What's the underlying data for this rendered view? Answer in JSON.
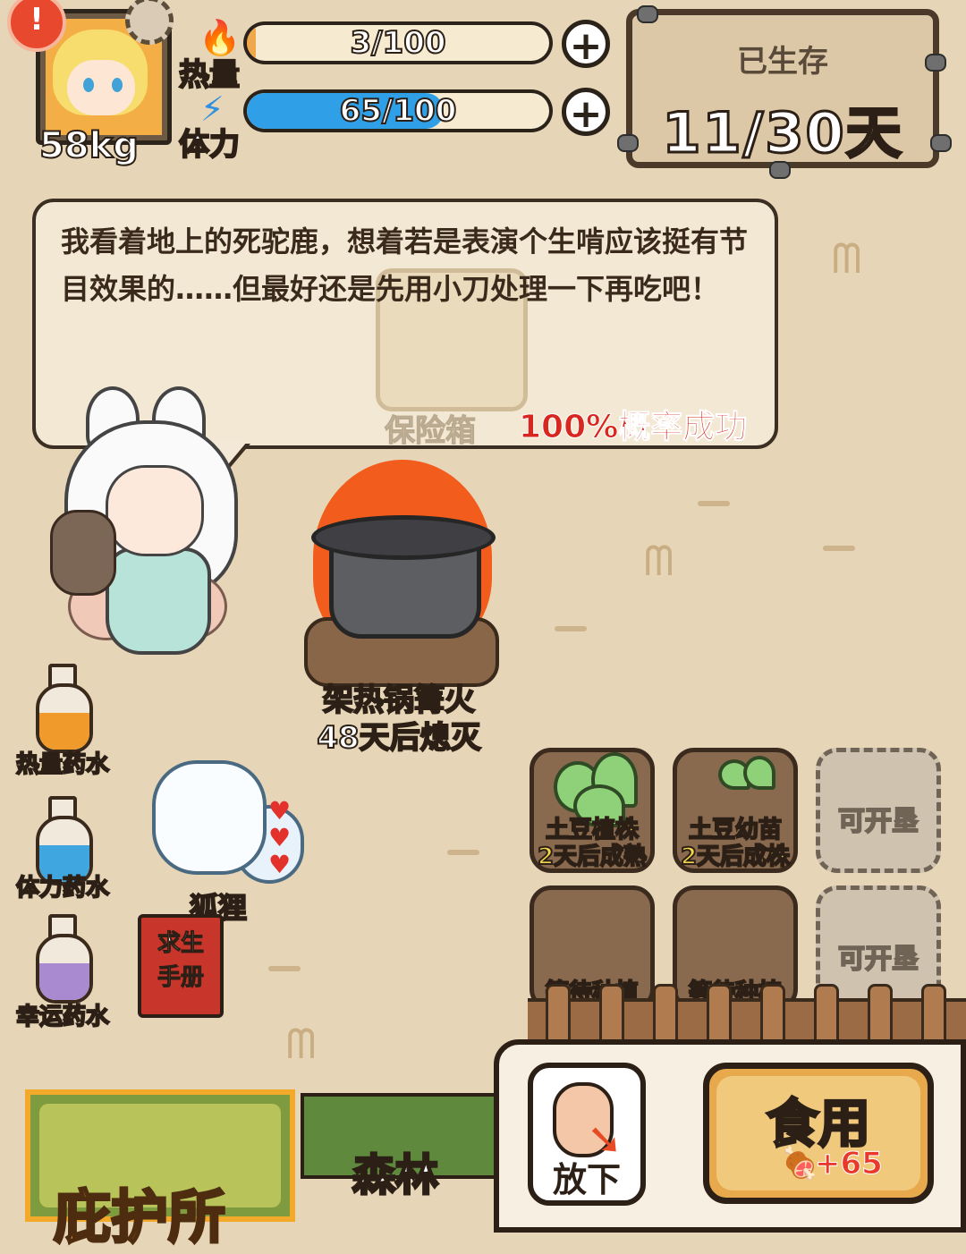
{
  "player": {
    "weight": "58kg"
  },
  "stats": {
    "heat": {
      "label": "热量",
      "value_text": "3/100",
      "fraction": 0.03
    },
    "stamina": {
      "label": "体力",
      "value_text": "65/100",
      "fraction": 0.65
    }
  },
  "survival": {
    "title": "已生存",
    "days": "11/30天"
  },
  "dialog": {
    "text": "我看着地上的死驼鹿，想着若是表演个生啃应该挺有节目效果的……但最好还是先用小刀处理一下再吃吧！",
    "object_label": "保险箱",
    "success_rate": "100%概率成功"
  },
  "campfire": {
    "name": "架热锅篝火",
    "status": "48天后熄灭"
  },
  "potions": [
    {
      "label": "热量药水",
      "color": "#f09a2c"
    },
    {
      "label": "体力药水",
      "color": "#3fa6e0"
    },
    {
      "label": "幸运药水",
      "color": "#a98ad0"
    }
  ],
  "pet": {
    "name": "狐狸",
    "hearts": 3
  },
  "manual": {
    "line1": "求生",
    "line2": "手册"
  },
  "farm": {
    "plots": [
      {
        "name": "土豆植株",
        "status": "2天后成熟"
      },
      {
        "name": "土豆幼苗",
        "status": "2天后成株"
      },
      {
        "name": "可开垦"
      },
      {
        "name": "等待种植"
      },
      {
        "name": "等待种植"
      },
      {
        "name": "可开垦"
      }
    ]
  },
  "locations": {
    "current": "庇护所",
    "next": "森林"
  },
  "actions": {
    "put_down": "放下",
    "eat": "食用",
    "eat_gain": "+65"
  },
  "colors": {
    "heat_bar": "#f6ead0",
    "stamina_bar": "#2f9fe8",
    "success_text": "#d8271e",
    "accent": "#f3a92a"
  }
}
